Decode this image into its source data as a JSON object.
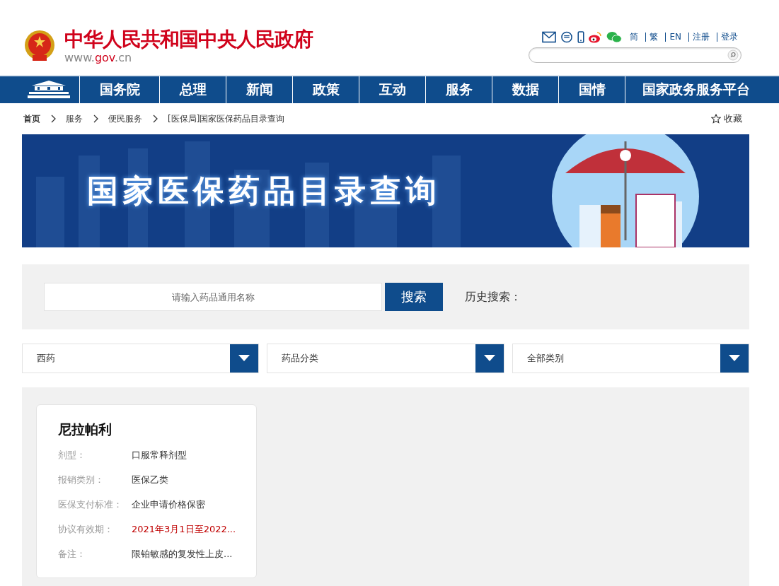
{
  "header": {
    "site_title": "中华人民共和国中央人民政府",
    "domain_parts": [
      "www.",
      "gov",
      ".cn"
    ],
    "lang_links": [
      "简",
      "繁",
      "EN",
      "注册",
      "登录"
    ]
  },
  "nav": {
    "items": [
      "国务院",
      "总理",
      "新闻",
      "政策",
      "互动",
      "服务",
      "数据",
      "国情",
      "国家政务服务平台"
    ]
  },
  "breadcrumb": {
    "items": [
      "首页",
      "服务",
      "便民服务",
      "[医保局]国家医保药品目录查询"
    ],
    "favorite": "收藏"
  },
  "banner": {
    "title": "国家医保药品目录查询"
  },
  "search": {
    "placeholder": "请输入药品通用名称",
    "button": "搜索",
    "history_label": "历史搜索："
  },
  "filters": [
    "西药",
    "药品分类",
    "全部类别"
  ],
  "drug_card": {
    "name": "尼拉帕利",
    "rows": [
      {
        "label": "剂型：",
        "value": "口服常释剂型",
        "highlight": false
      },
      {
        "label": "报销类别：",
        "value": "医保乙类",
        "highlight": false
      },
      {
        "label": "医保支付标准：",
        "value": "企业申请价格保密",
        "highlight": false
      },
      {
        "label": "协议有效期：",
        "value": "2021年3月1日至2022...",
        "highlight": true
      },
      {
        "label": "备注：",
        "value": "限铂敏感的复发性上皮...",
        "highlight": false
      }
    ]
  }
}
